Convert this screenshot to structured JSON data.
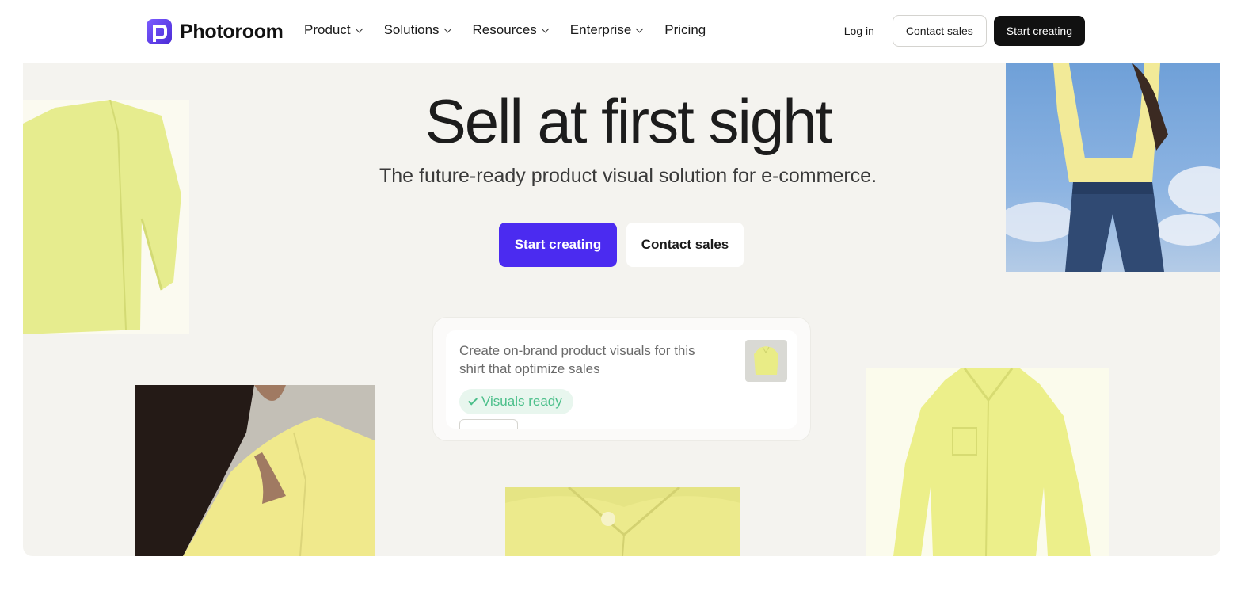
{
  "nav": {
    "brand": "Photoroom",
    "links": [
      {
        "label": "Product",
        "dropdown": true
      },
      {
        "label": "Solutions",
        "dropdown": true
      },
      {
        "label": "Resources",
        "dropdown": true
      },
      {
        "label": "Enterprise",
        "dropdown": true
      },
      {
        "label": "Pricing",
        "dropdown": false
      }
    ],
    "login": "Log in",
    "contact_sales": "Contact sales",
    "start_creating": "Start creating"
  },
  "hero": {
    "headline": "Sell at first sight",
    "subheadline": "The future-ready product visual solution for e-commerce.",
    "primary_cta": "Start creating",
    "secondary_cta": "Contact sales"
  },
  "prompt_card": {
    "prompt": "Create on-brand product visuals for this shirt that optimize sales",
    "status": "Visuals ready"
  },
  "colors": {
    "primary": "#4b2bf0",
    "dark_button": "#111111",
    "hero_bg": "#f4f3ef",
    "shirt_yellow": "#e9ec86",
    "status_green": "#4bbf8a"
  }
}
